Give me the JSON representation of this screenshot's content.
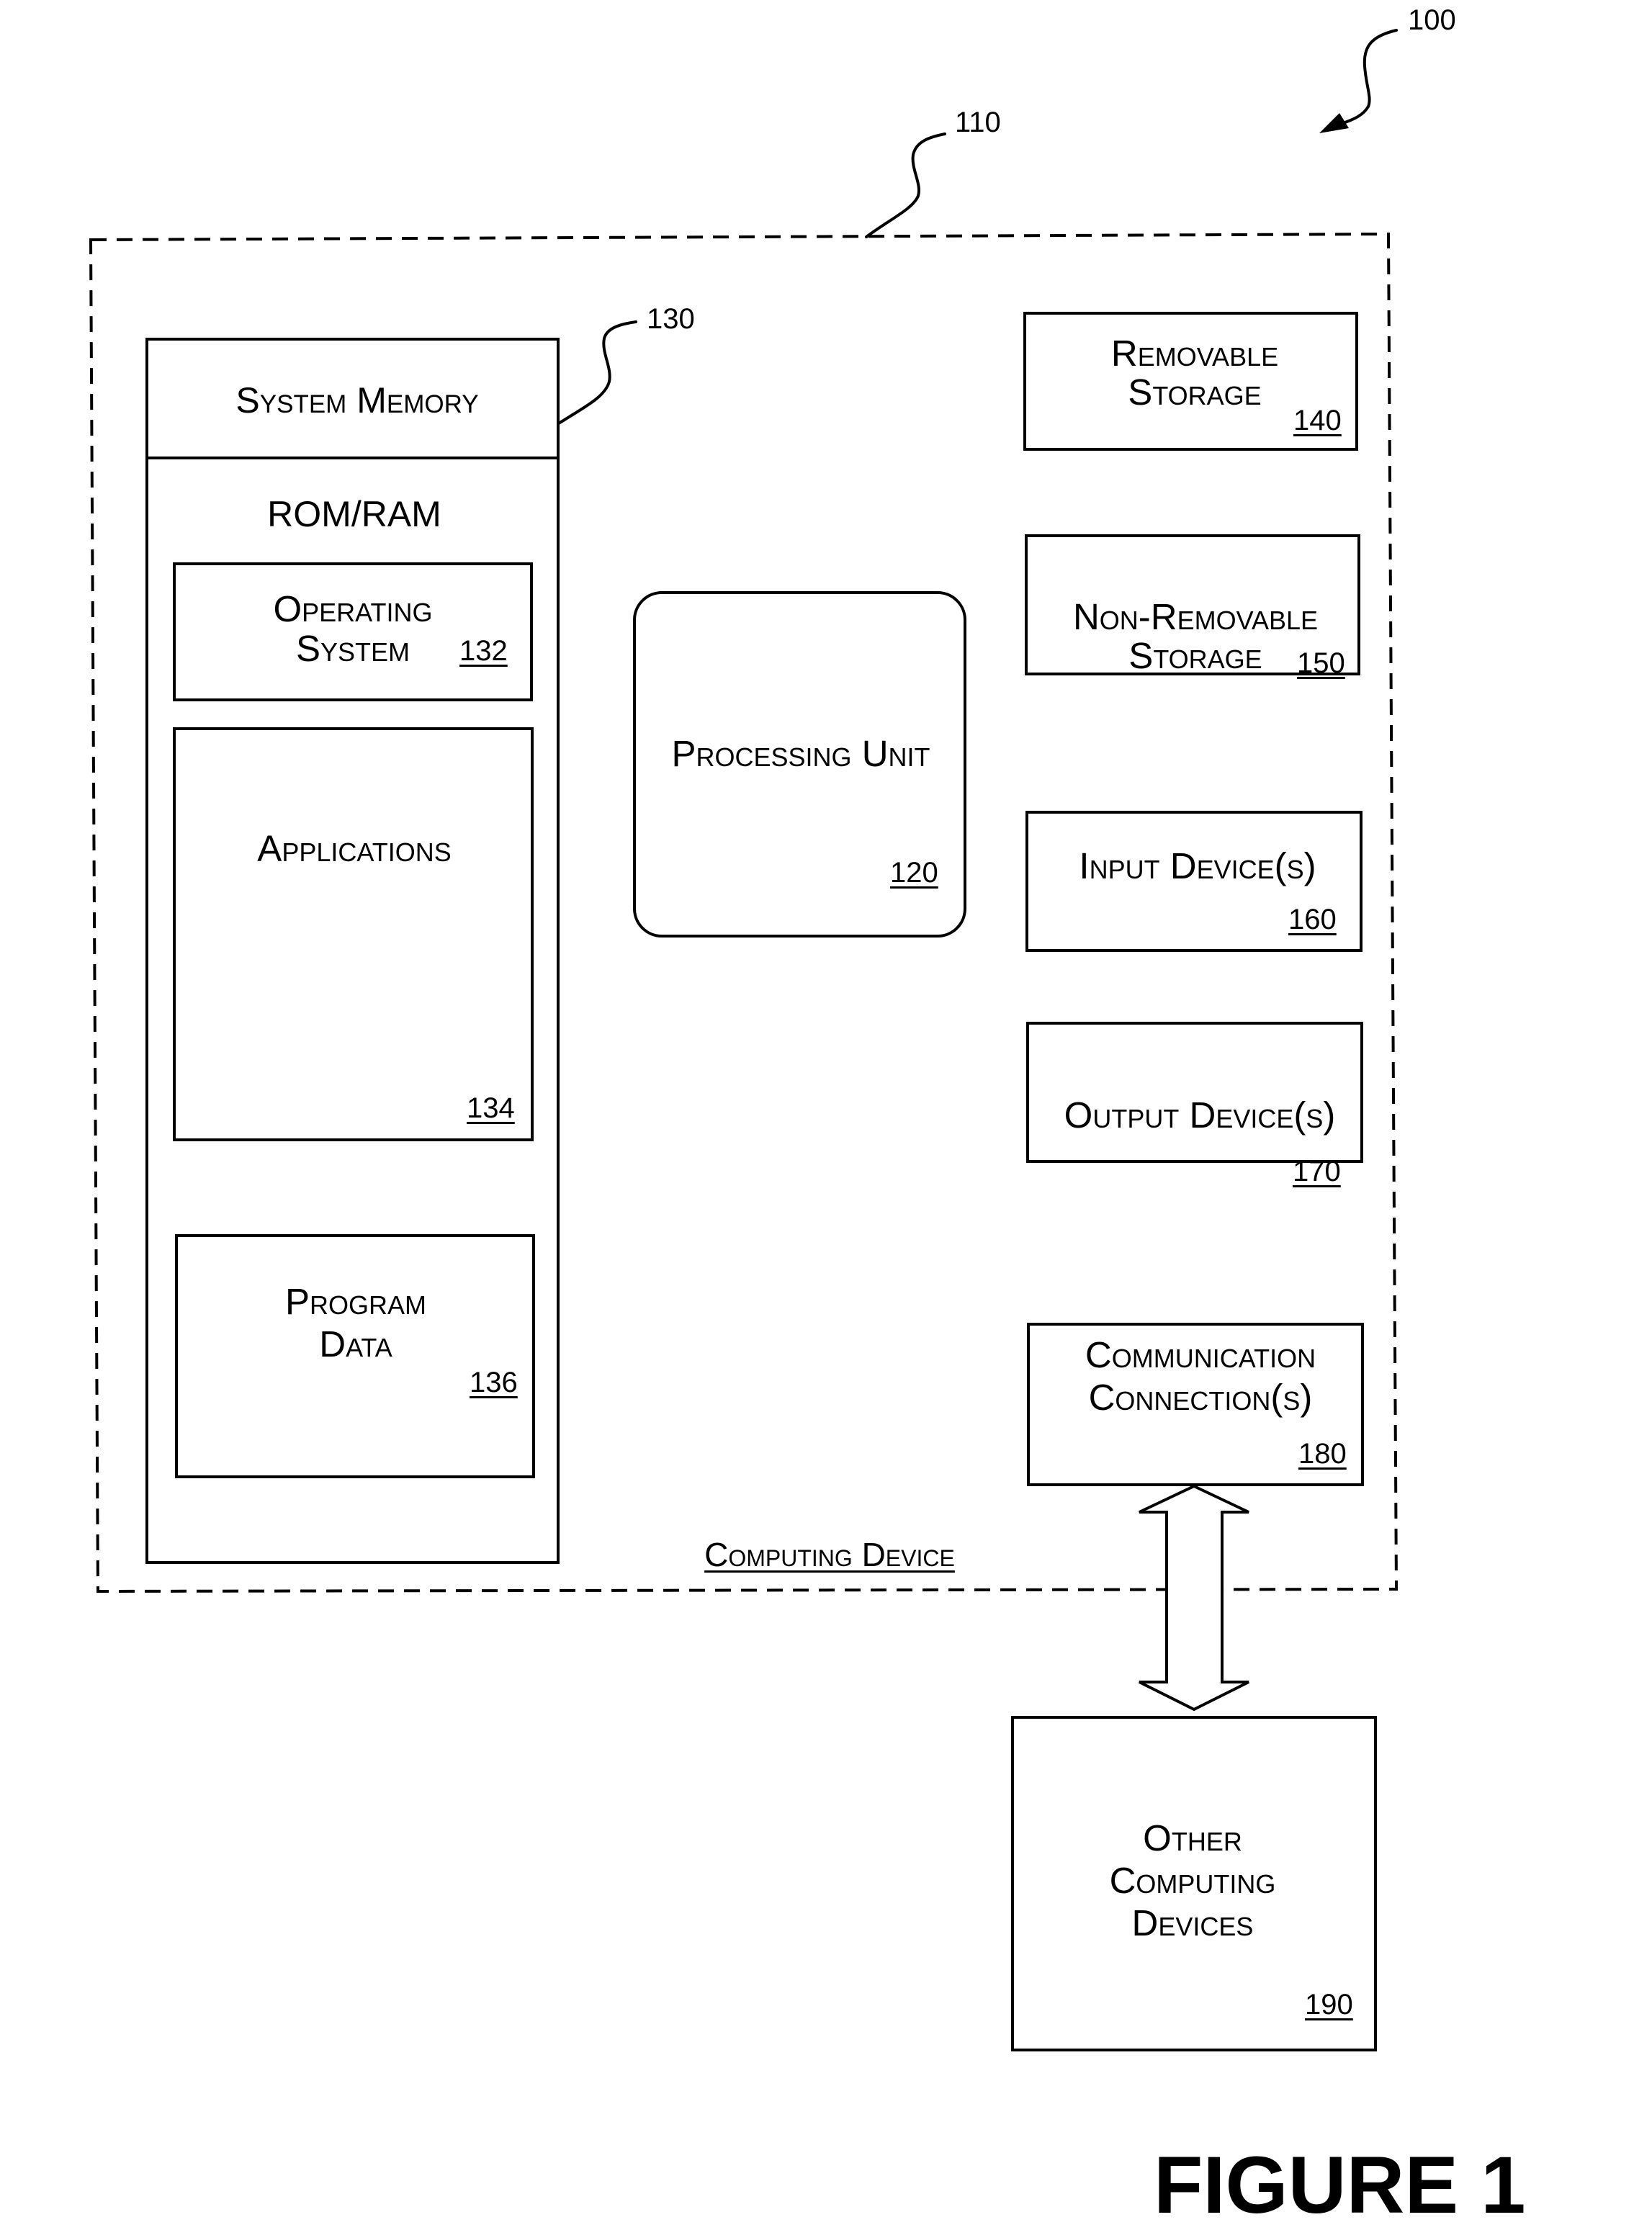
{
  "figure_title": "FIGURE 1",
  "callouts": {
    "system": "100",
    "computing_device": "110",
    "system_memory": "130"
  },
  "computing_device": {
    "label": "Computing Device",
    "system_memory": {
      "header": "System Memory",
      "rom_ram": "ROM/RAM",
      "operating_system": {
        "line1": "Operating",
        "line2": "System",
        "ref": "132"
      },
      "applications": {
        "label": "Applications",
        "ref": "134"
      },
      "program_data": {
        "line1": "Program",
        "line2": "Data",
        "ref": "136"
      }
    },
    "processing_unit": {
      "label": "Processing Unit",
      "ref": "120"
    },
    "removable_storage": {
      "line1": "Removable",
      "line2": "Storage",
      "ref": "140"
    },
    "non_removable_storage": {
      "line1": "Non-Removable",
      "line2": "Storage",
      "ref": "150"
    },
    "input_devices": {
      "label": "Input Device(s)",
      "ref": "160"
    },
    "output_devices": {
      "label": "Output Device(s)",
      "ref": "170"
    },
    "communication_connections": {
      "line1": "Communication",
      "line2": "Connection(s)",
      "ref": "180"
    }
  },
  "other_computing_devices": {
    "line1": "Other",
    "line2": "Computing",
    "line3": "Devices",
    "ref": "190"
  }
}
